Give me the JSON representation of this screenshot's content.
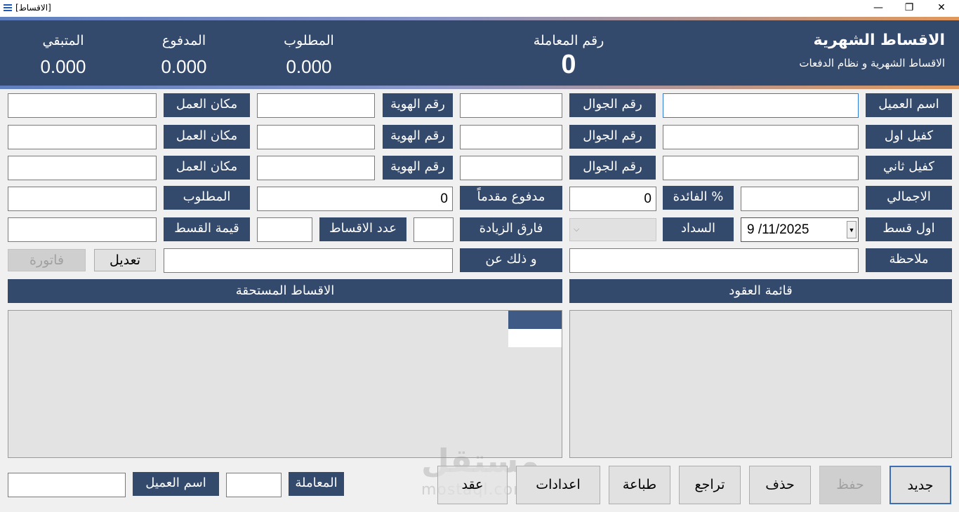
{
  "window": {
    "title": "[الاقساط]",
    "minimize": "—",
    "maximize": "❐",
    "close": "✕"
  },
  "header": {
    "title": "الاقساط الشهرية",
    "subtitle": "الاقساط الشهرية و نظام الدفعات",
    "transaction_label": "رقم المعاملة",
    "transaction_value": "0",
    "required_label": "المطلوب",
    "required_value": "0.000",
    "paid_label": "المدفوع",
    "paid_value": "0.000",
    "remaining_label": "المتبقي",
    "remaining_value": "0.000"
  },
  "form": {
    "customer_name": "اسم العميل",
    "guarantor1": "كفيل اول",
    "guarantor2": "كفيل ثاني",
    "total": "الاجمالي",
    "first_installment": "اول قسط",
    "note": "ملاحظة",
    "mobile": "رقم الجوال",
    "interest": "الفائدة %",
    "interest_value": "0",
    "payment": "السداد",
    "id_number": "رقم الهوية",
    "down_payment": "مدفوع مقدماً",
    "down_payment_value": "0",
    "increase_diff": "فارق الزيادة",
    "and_that_for": "و ذلك عن",
    "installments_count": "عدد الاقساط",
    "workplace": "مكان العمل",
    "required": "المطلوب",
    "installment_value": "قيمة القسط",
    "date_value": "9 /11/2025",
    "edit_button": "تعديل",
    "invoice_button": "فاتورة"
  },
  "sections": {
    "contracts_list": "قائمة العقود",
    "due_installments": "الاقساط المستحقة"
  },
  "bottom": {
    "new": "جديد",
    "save": "حفظ",
    "delete": "حذف",
    "undo": "تراجع",
    "print": "طباعة",
    "settings": "اعدادات",
    "contract": "عقد",
    "transaction_label": "المعاملة",
    "customer_label": "اسم العميل"
  },
  "watermark": {
    "text": "مستقل",
    "url_text": "mostaql.com"
  },
  "colors": {
    "header_bg": "#344a6d",
    "label_bg": "#344a6d",
    "panel_bg": "#e3e3e3"
  }
}
